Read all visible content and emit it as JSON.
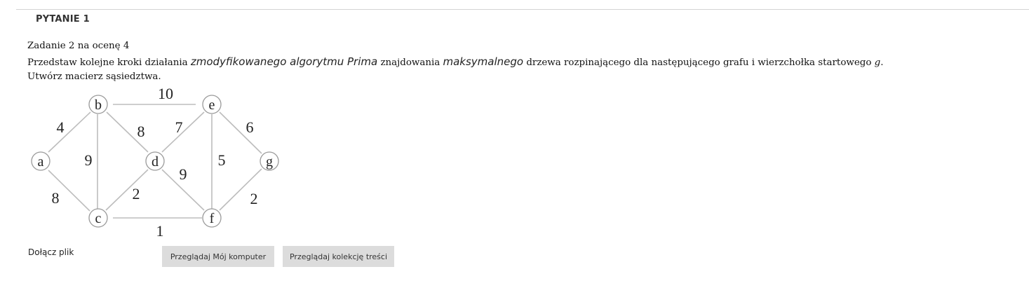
{
  "question": {
    "header": "PYTANIE 1",
    "title": "Zadanie 2 na ocenę 4",
    "line2": {
      "p1": "Przedstaw kolejne kroki działania ",
      "p2": "zmodyfikowanego algorytmu Prima",
      "p3": " znajdowania ",
      "p4": "maksymalnego",
      "p5": " drzewa rozpinającego dla następującego grafu i wierzchołka startowego ",
      "p6": "g",
      "p7": "."
    },
    "line3": "Utwórz macierz sąsiedztwa."
  },
  "graph": {
    "nodes": {
      "a": "a",
      "b": "b",
      "c": "c",
      "d": "d",
      "e": "e",
      "f": "f",
      "g": "g"
    },
    "edges": {
      "a_b": "4",
      "a_c": "8",
      "b_c": "9",
      "b_d": "8",
      "b_e": "10",
      "c_d": "2",
      "c_f": "1",
      "d_e": "7",
      "d_f": "9",
      "e_f": "5",
      "e_g": "6",
      "f_g": "2"
    }
  },
  "attachment": {
    "label": "Dołącz plik",
    "browse_computer": "Przeglądaj Mój komputer",
    "browse_content": "Przeglądaj kolekcję treści"
  }
}
